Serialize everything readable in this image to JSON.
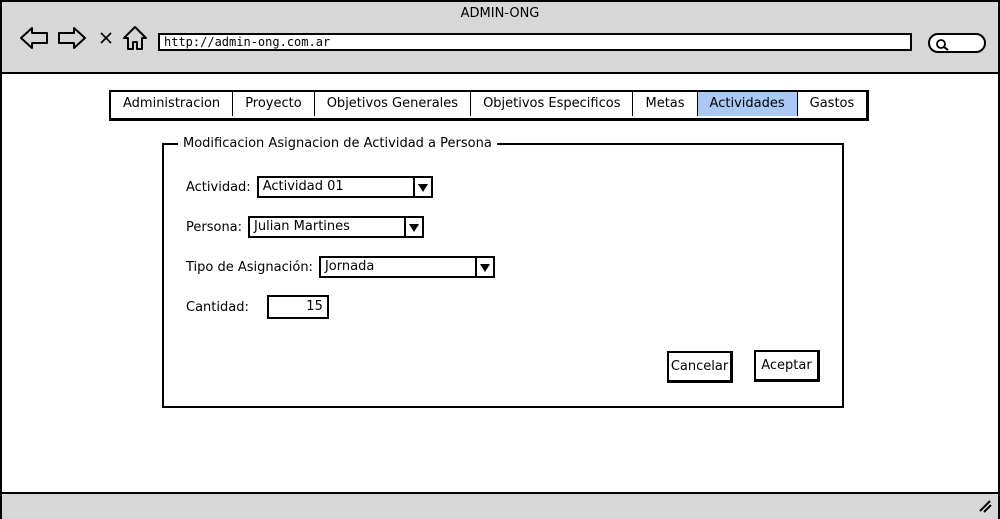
{
  "window": {
    "title": "ADMIN-ONG",
    "url": "http://admin-ong.com.ar"
  },
  "tabs": [
    {
      "label": "Administracion",
      "active": false
    },
    {
      "label": "Proyecto",
      "active": false
    },
    {
      "label": "Objetivos Generales",
      "active": false
    },
    {
      "label": "Objetivos Especificos",
      "active": false
    },
    {
      "label": "Metas",
      "active": false
    },
    {
      "label": "Actividades",
      "active": true
    },
    {
      "label": "Gastos",
      "active": false
    }
  ],
  "form": {
    "legend": "Modificacion Asignacion de Actividad a Persona",
    "actividad": {
      "label": "Actividad:",
      "value": "Actividad 01"
    },
    "persona": {
      "label": "Persona:",
      "value": "Julian Martines"
    },
    "tipo": {
      "label": "Tipo de Asignación:",
      "value": "Jornada"
    },
    "cantidad": {
      "label": "Cantidad:",
      "value": "15"
    },
    "cancel_label": "Cancelar",
    "accept_label": "Aceptar"
  },
  "colors": {
    "active_tab": "#a9c8f3",
    "chrome": "#d7d7d7"
  }
}
